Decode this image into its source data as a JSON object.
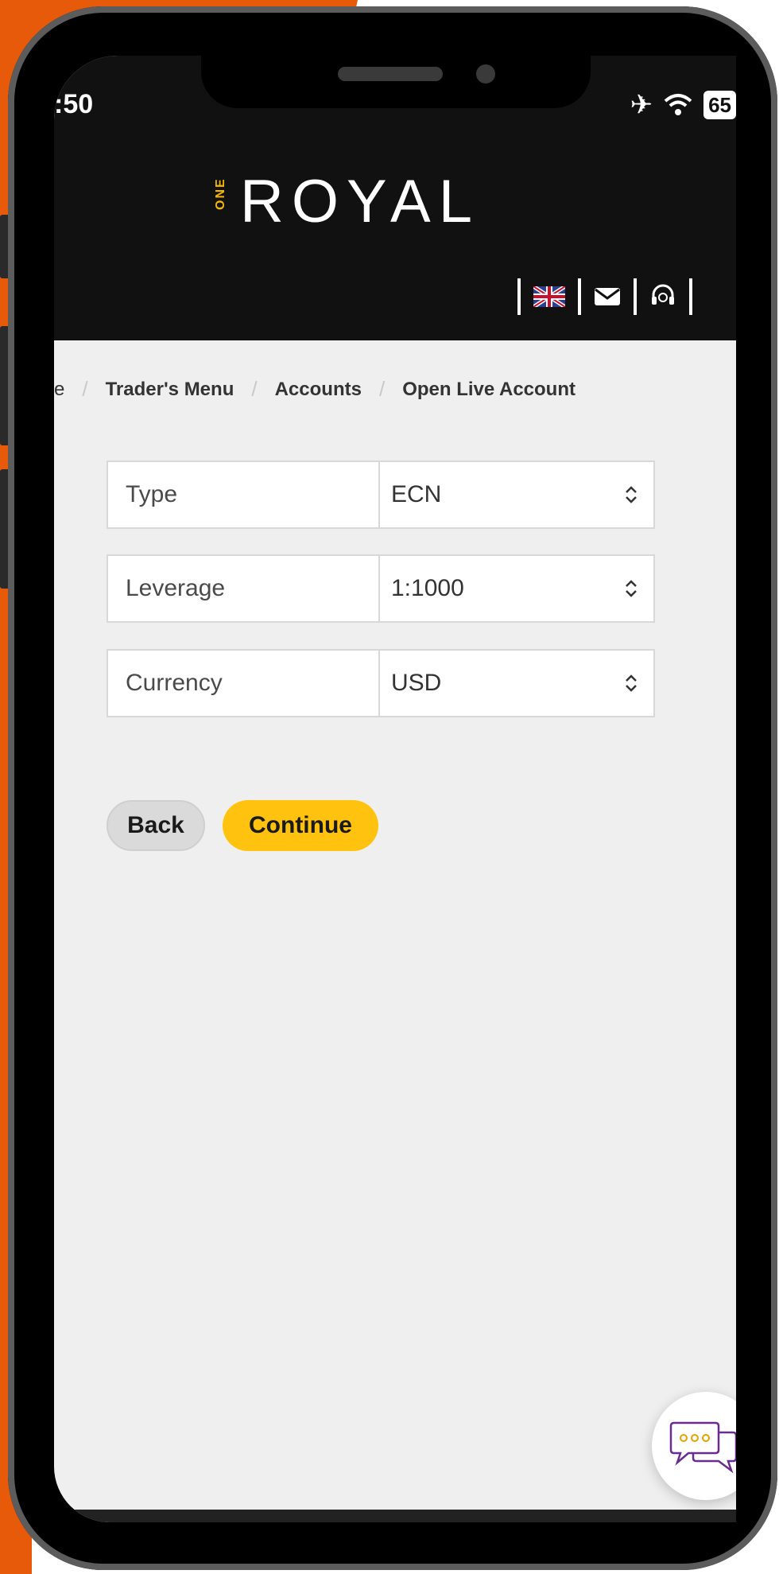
{
  "status": {
    "time": ":50",
    "battery": "65"
  },
  "header": {
    "logo_one": "ONE",
    "logo_text": "ROYAL"
  },
  "breadcrumb": [
    "e",
    "Trader's Menu",
    "Accounts",
    "Open Live Account"
  ],
  "form": {
    "fields": [
      {
        "label": "Type",
        "value": "ECN"
      },
      {
        "label": "Leverage",
        "value": "1:1000"
      },
      {
        "label": "Currency",
        "value": "USD"
      }
    ]
  },
  "buttons": {
    "back": "Back",
    "continue": "Continue"
  },
  "colors": {
    "accent": "#ffc20e",
    "logo_accent": "#f6b700",
    "background_orange": "#e65a0a",
    "header": "#111111"
  },
  "icons": {
    "status": [
      "airplane-icon",
      "wifi-icon",
      "battery-icon"
    ],
    "header": [
      "uk-flag-icon",
      "mail-icon",
      "support-headset-icon"
    ],
    "select": "updown-chevron-icon",
    "chat": "chat-bubble-icon"
  }
}
